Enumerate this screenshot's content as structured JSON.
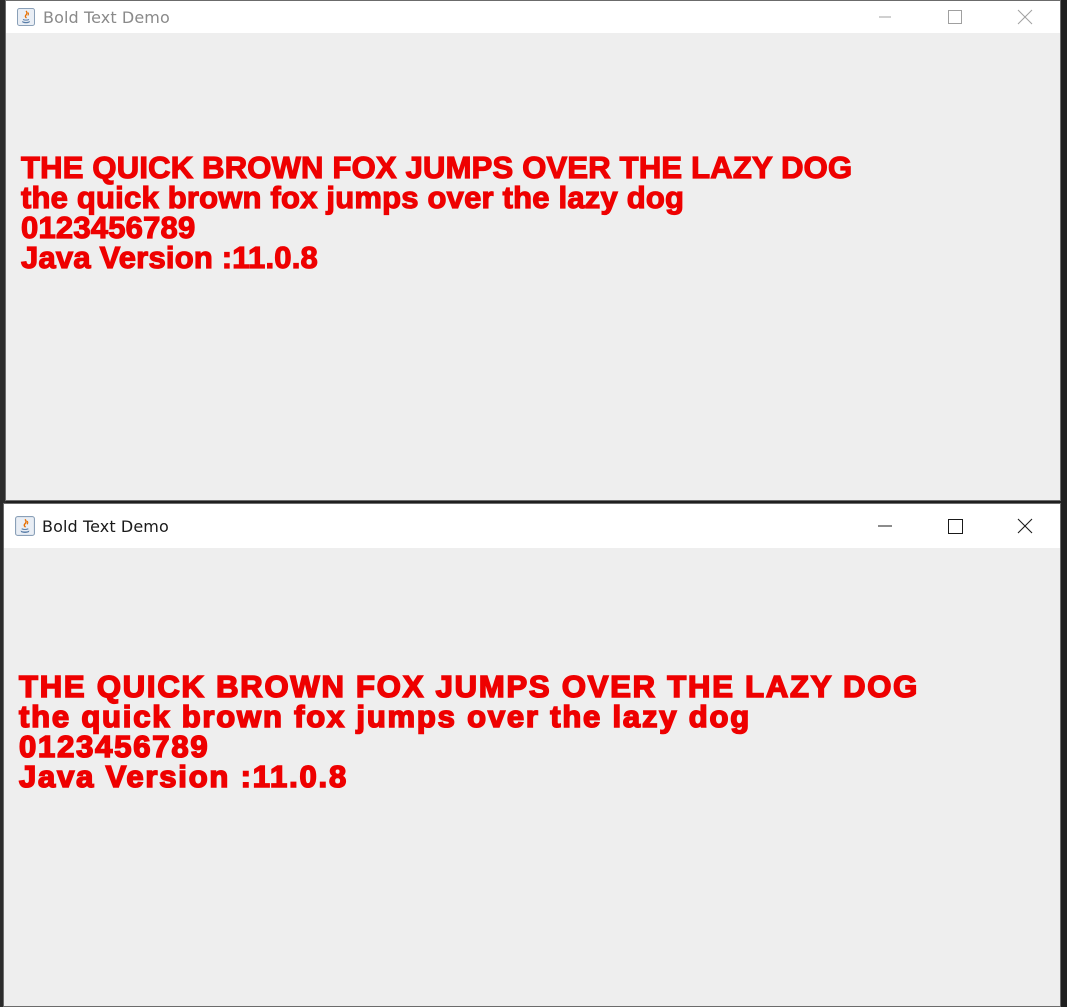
{
  "windows": [
    {
      "title": "Bold Text Demo",
      "lines": [
        "THE QUICK BROWN FOX JUMPS OVER THE LAZY DOG",
        "the quick brown fox jumps over the lazy dog",
        "0123456789",
        "Java Version :11.0.8"
      ],
      "title_color": "#8a8a8a",
      "text_color": "#ee0000",
      "icon": "java-icon"
    },
    {
      "title": "Bold Text Demo",
      "lines": [
        "THE QUICK BROWN FOX JUMPS OVER THE LAZY DOG",
        "the quick brown fox jumps over the lazy dog",
        "0123456789",
        "Java Version :11.0.8"
      ],
      "title_color": "#1a1a1a",
      "text_color": "#ee0000",
      "icon": "java-icon"
    }
  ],
  "controls": {
    "minimize_icon": "minimize-icon",
    "maximize_icon": "maximize-icon",
    "close_icon": "close-icon"
  }
}
